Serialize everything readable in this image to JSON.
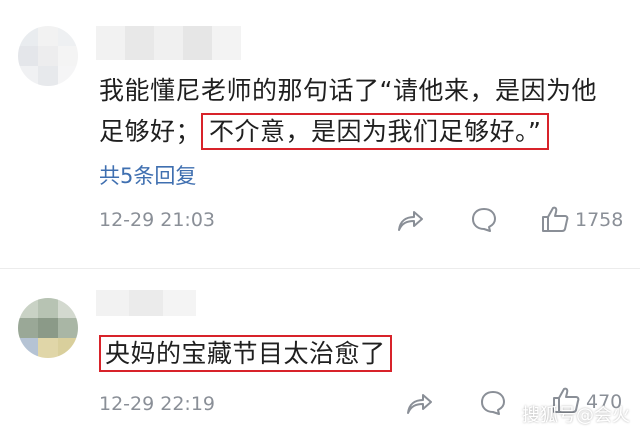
{
  "comments": [
    {
      "text_line1": "我能懂尼老师的那句话了“请他来，是因为他",
      "text_line2_prefix": "足够好；",
      "text_line2_highlight": "不介意，是因为我们足够好。”",
      "replies": "共5条回复",
      "time": "12-29 21:03",
      "likes": "1758"
    },
    {
      "text_highlight": "央妈的宝藏节目太治愈了",
      "time": "12-29 22:19",
      "likes": "470"
    }
  ],
  "watermark": "搜狐号@会火",
  "colors": {
    "highlight_border": "#d8232a",
    "link": "#3f6fb0",
    "meta": "#8a8f97"
  },
  "icons": [
    "share-icon",
    "comment-icon",
    "like-icon"
  ]
}
